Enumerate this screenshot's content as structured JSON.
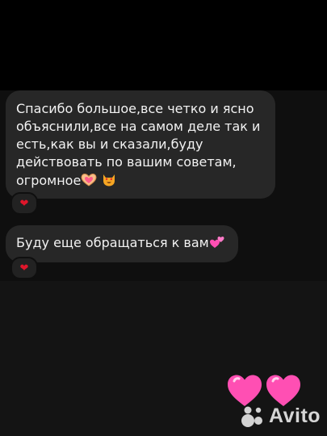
{
  "chat": {
    "messages": [
      {
        "text": "Спасибо большое,все четко и ясно объяснили,все на самом деле так и есть,как вы и сказали,буду действовать по вашим советам, огромное",
        "trailing_emoji": [
          "heart-hands-icon",
          "heart-eyes-cat-icon"
        ],
        "reaction": "❤"
      },
      {
        "text": "Буду еще обращаться к вам",
        "trailing_emoji": [
          "two-hearts-icon"
        ],
        "reaction": "❤"
      }
    ]
  },
  "decoration": {
    "hearts": [
      "pink-heart-icon",
      "pink-heart-icon"
    ]
  },
  "watermark": {
    "text": "Avito",
    "logo": "avito-dots-logo"
  },
  "colors": {
    "bubble": "#272727",
    "reaction_heart": "#e0162b",
    "pink_heart": "#ff4fb3"
  }
}
